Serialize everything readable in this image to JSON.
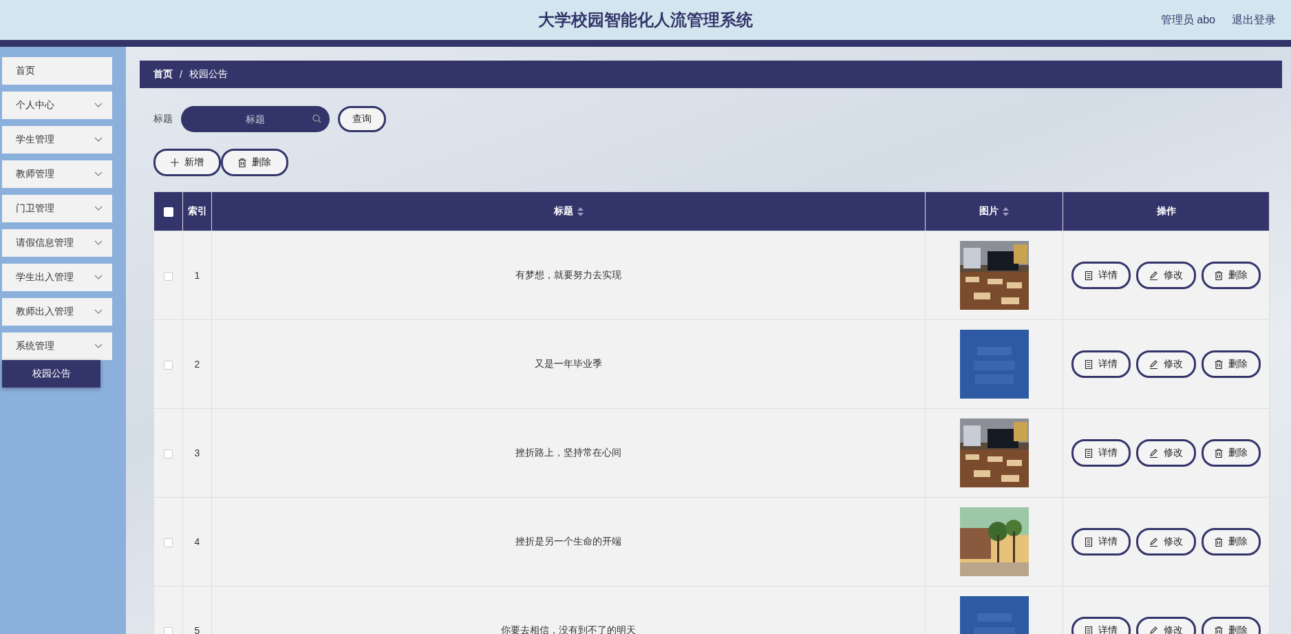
{
  "header": {
    "title": "大学校园智能化人流管理系统",
    "user": "管理员 abo",
    "logout": "退出登录"
  },
  "sidebar": {
    "items": [
      {
        "label": "首页",
        "expandable": false,
        "selected": false
      },
      {
        "label": "个人中心",
        "expandable": true,
        "selected": false
      },
      {
        "label": "学生管理",
        "expandable": true,
        "selected": false
      },
      {
        "label": "教师管理",
        "expandable": true,
        "selected": false
      },
      {
        "label": "门卫管理",
        "expandable": true,
        "selected": false
      },
      {
        "label": "请假信息管理",
        "expandable": true,
        "selected": false
      },
      {
        "label": "学生出入管理",
        "expandable": true,
        "selected": false
      },
      {
        "label": "教师出入管理",
        "expandable": true,
        "selected": false
      },
      {
        "label": "系统管理",
        "expandable": true,
        "expanded": true,
        "selected": false,
        "children": [
          {
            "label": "校园公告",
            "selected": true
          }
        ]
      }
    ]
  },
  "breadcrumb": [
    "首页",
    "/",
    "校园公告"
  ],
  "search": {
    "label": "标题",
    "placeholder": "标题",
    "button": "查询"
  },
  "toolbar": {
    "add": "新增",
    "delete": "删除"
  },
  "table": {
    "header_checked": false,
    "columns": [
      {
        "label": "索引",
        "sortable": false
      },
      {
        "label": "标题",
        "sortable": true
      },
      {
        "label": "图片",
        "sortable": true
      },
      {
        "label": "操作",
        "sortable": false
      }
    ],
    "rows": [
      {
        "checked": false,
        "index": "1",
        "title": "有梦想，就要努力去实现",
        "image": {
          "kind": "picture"
        },
        "actions": [
          "详情",
          "修改",
          "删除"
        ]
      },
      {
        "checked": false,
        "index": "2",
        "title": "又是一年毕业季",
        "image": {
          "kind": "picture"
        },
        "actions": [
          "详情",
          "修改",
          "删除"
        ]
      },
      {
        "checked": false,
        "index": "3",
        "title": "挫折路上，坚持常在心间",
        "image": {
          "kind": "picture"
        },
        "actions": [
          "详情",
          "修改",
          "删除"
        ]
      },
      {
        "checked": false,
        "index": "4",
        "title": "挫折是另一个生命的开端",
        "image": {
          "kind": "picture"
        },
        "actions": [
          "详情",
          "修改",
          "删除"
        ]
      },
      {
        "checked": false,
        "index": "5",
        "title": "你要去相信，没有到不了的明天",
        "image": {
          "kind": "picture"
        },
        "actions": [
          "详情",
          "修改",
          "删除"
        ]
      }
    ]
  }
}
